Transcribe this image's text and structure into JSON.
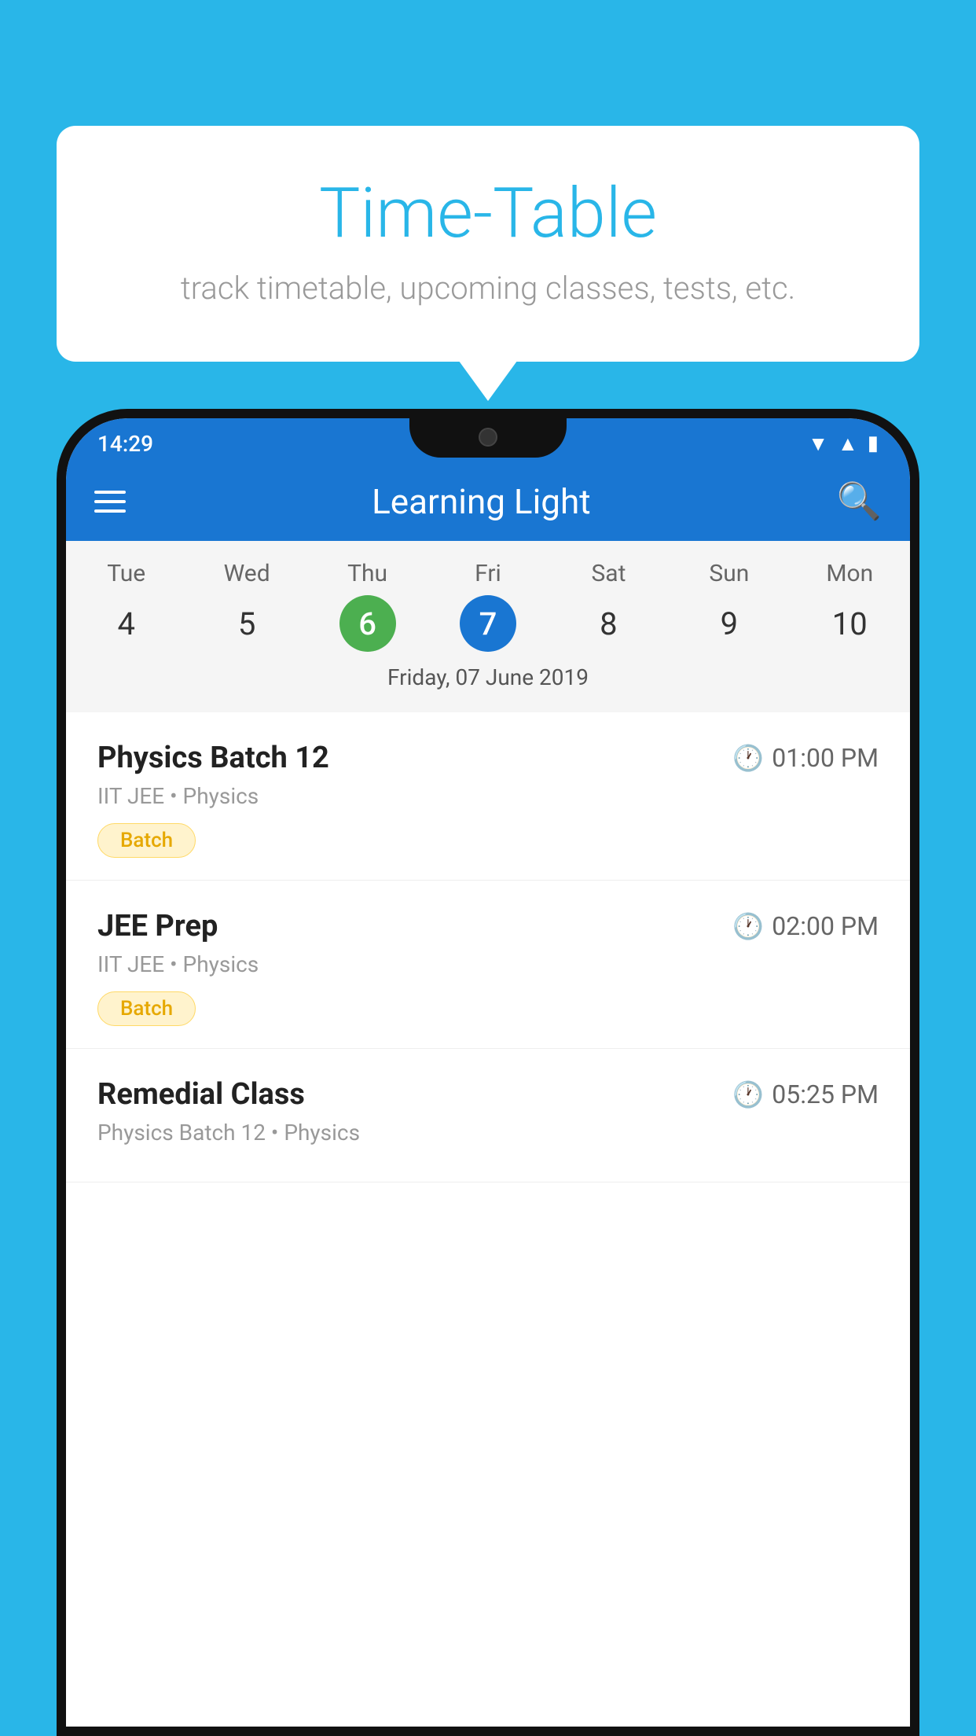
{
  "background": {
    "color": "#29B6E8"
  },
  "tooltip": {
    "title": "Time-Table",
    "subtitle": "track timetable, upcoming classes, tests, etc."
  },
  "app_bar": {
    "title": "Learning Light",
    "menu_icon": "hamburger-icon",
    "search_icon": "search-icon"
  },
  "status_bar": {
    "time": "14:29"
  },
  "calendar": {
    "selected_date": "Friday, 07 June 2019",
    "days": [
      {
        "name": "Tue",
        "num": "4",
        "state": "normal"
      },
      {
        "name": "Wed",
        "num": "5",
        "state": "normal"
      },
      {
        "name": "Thu",
        "num": "6",
        "state": "today"
      },
      {
        "name": "Fri",
        "num": "7",
        "state": "selected"
      },
      {
        "name": "Sat",
        "num": "8",
        "state": "normal"
      },
      {
        "name": "Sun",
        "num": "9",
        "state": "normal"
      },
      {
        "name": "Mon",
        "num": "10",
        "state": "normal"
      }
    ]
  },
  "schedule": {
    "items": [
      {
        "name": "Physics Batch 12",
        "time": "01:00 PM",
        "meta": "IIT JEE • Physics",
        "tag": "Batch"
      },
      {
        "name": "JEE Prep",
        "time": "02:00 PM",
        "meta": "IIT JEE • Physics",
        "tag": "Batch"
      },
      {
        "name": "Remedial Class",
        "time": "05:25 PM",
        "meta": "Physics Batch 12 • Physics",
        "tag": ""
      }
    ]
  }
}
